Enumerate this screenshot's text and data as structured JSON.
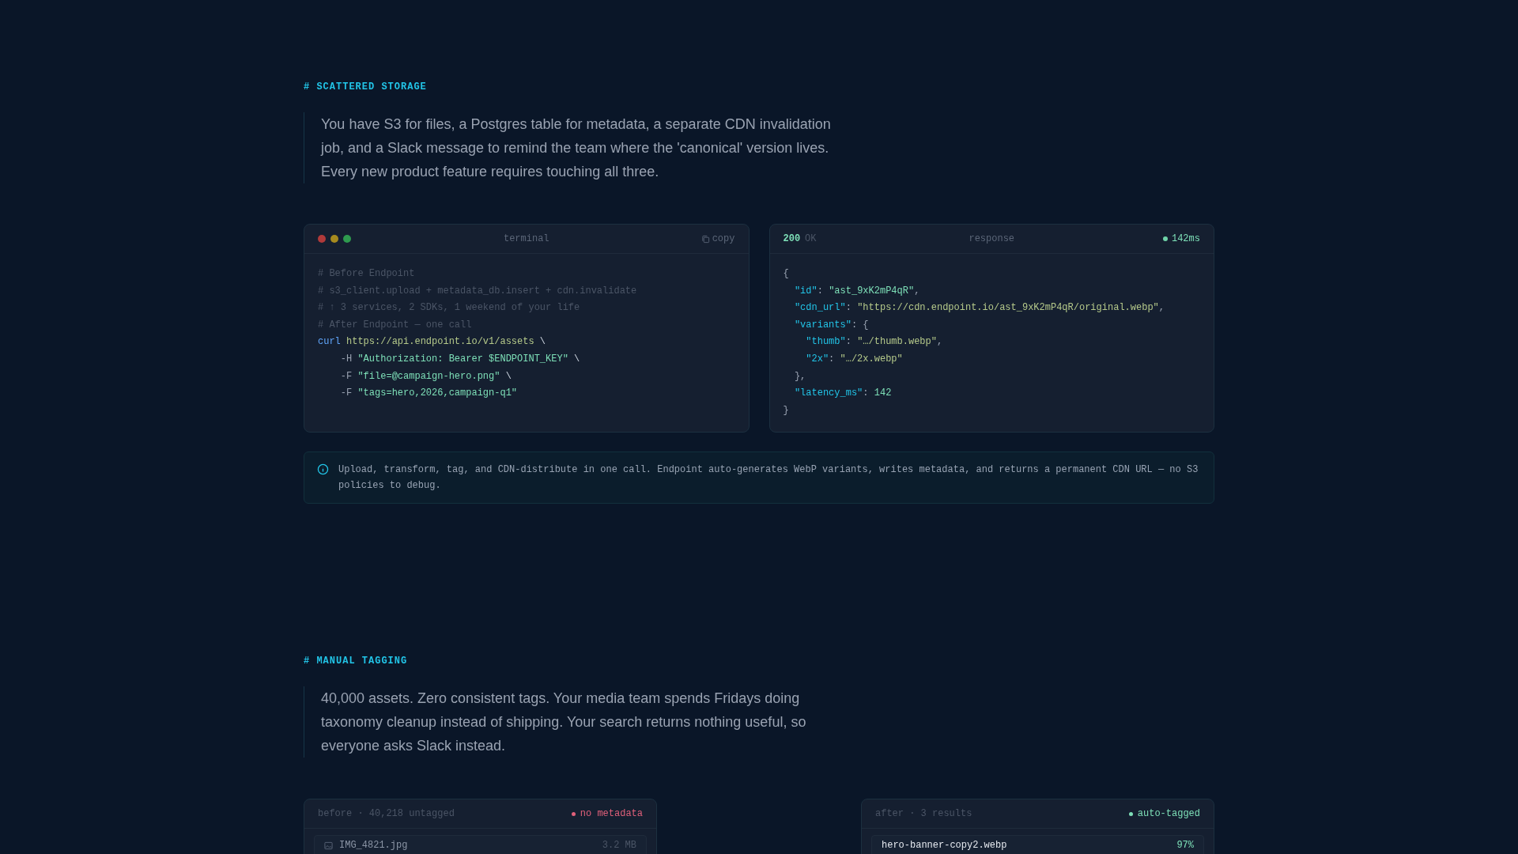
{
  "sections": [
    {
      "heading": "# SCATTERED STORAGE",
      "paragraph": "You have S3 for files, a Postgres table for metadata, a separate CDN invalidation job, and a Slack message to remind the team where the 'canonical' version lives. Every new product feature requires touching all three.",
      "terminal": {
        "title": "terminal",
        "copy": "copy",
        "lines": [
          [
            {
              "kind": "comment",
              "text": "# Before Endpoint"
            }
          ],
          [
            {
              "kind": "comment",
              "text": "# s3_client.upload + metadata_db.insert + cdn.invalidate"
            }
          ],
          [
            {
              "kind": "comment",
              "text": "# ↑ 3 services, 2 SDKs, 1 weekend of your life"
            }
          ],
          [
            {
              "kind": "comment",
              "text": "# After Endpoint — one call"
            }
          ],
          [
            {
              "kind": "keyword",
              "text": "curl "
            },
            {
              "kind": "url",
              "text": "https://api.endpoint.io/v1/assets"
            },
            {
              "kind": "plain",
              "text": " \\"
            }
          ],
          [
            {
              "kind": "flag",
              "text": "    -H "
            },
            {
              "kind": "string",
              "text": "\"Authorization: Bearer $ENDPOINT_KEY\""
            },
            {
              "kind": "plain",
              "text": " \\"
            }
          ],
          [
            {
              "kind": "flag",
              "text": "    -F "
            },
            {
              "kind": "string",
              "text": "\"file=@campaign-hero.png\""
            },
            {
              "kind": "plain",
              "text": " \\"
            }
          ],
          [
            {
              "kind": "flag",
              "text": "    -F "
            },
            {
              "kind": "string",
              "text": "\"tags=hero,2026,campaign-q1\""
            }
          ]
        ]
      },
      "response": {
        "code": "200",
        "status": "OK",
        "title": "response",
        "latency": "142ms",
        "lines": [
          [
            {
              "kind": "punct",
              "text": "{"
            }
          ],
          [
            {
              "kind": "key",
              "text": "  \"id\""
            },
            {
              "kind": "punct",
              "text": ": "
            },
            {
              "kind": "string",
              "text": "\"ast_9xK2mP4qR\""
            },
            {
              "kind": "punct",
              "text": ","
            }
          ],
          [
            {
              "kind": "key",
              "text": "  \"cdn_url\""
            },
            {
              "kind": "punct",
              "text": ": "
            },
            {
              "kind": "url",
              "text": "\"https://cdn.endpoint.io/ast_9xK2mP4qR/original.webp\""
            },
            {
              "kind": "punct",
              "text": ","
            }
          ],
          [
            {
              "kind": "key",
              "text": "  \"variants\""
            },
            {
              "kind": "punct",
              "text": ": {"
            }
          ],
          [
            {
              "kind": "key",
              "text": "    \"thumb\""
            },
            {
              "kind": "punct",
              "text": ": "
            },
            {
              "kind": "url",
              "text": "\"…/thumb.webp\""
            },
            {
              "kind": "punct",
              "text": ","
            }
          ],
          [
            {
              "kind": "key",
              "text": "    \"2x\""
            },
            {
              "kind": "punct",
              "text": ": "
            },
            {
              "kind": "url",
              "text": "\"…/2x.webp\""
            }
          ],
          [
            {
              "kind": "punct",
              "text": "  },"
            }
          ],
          [
            {
              "kind": "key",
              "text": "  \"latency_ms\""
            },
            {
              "kind": "punct",
              "text": ": "
            },
            {
              "kind": "string",
              "text": "142"
            }
          ],
          [
            {
              "kind": "punct",
              "text": "}"
            }
          ]
        ]
      },
      "note": "Upload, transform, tag, and CDN-distribute in one call. Endpoint auto-generates WebP variants, writes metadata, and returns a permanent CDN URL — no S3 policies to debug."
    },
    {
      "heading": "# MANUAL TAGGING",
      "paragraph": "40,000 assets. Zero consistent tags. Your media team spends Fridays doing taxonomy cleanup instead of shipping. Your search returns nothing useful, so everyone asks Slack instead.",
      "panels": [
        {
          "kind": "before",
          "caption": "before · 40,218 untagged",
          "badge": "no metadata",
          "rows": [
            {
              "name": "IMG_4821.jpg",
              "meta": "3.2 MB"
            }
          ]
        },
        {
          "kind": "after",
          "caption": "after · 3 results",
          "badge": "auto-tagged",
          "rows": [
            {
              "name": "hero-banner-copy2.webp",
              "meta": "97%"
            }
          ]
        }
      ]
    }
  ]
}
